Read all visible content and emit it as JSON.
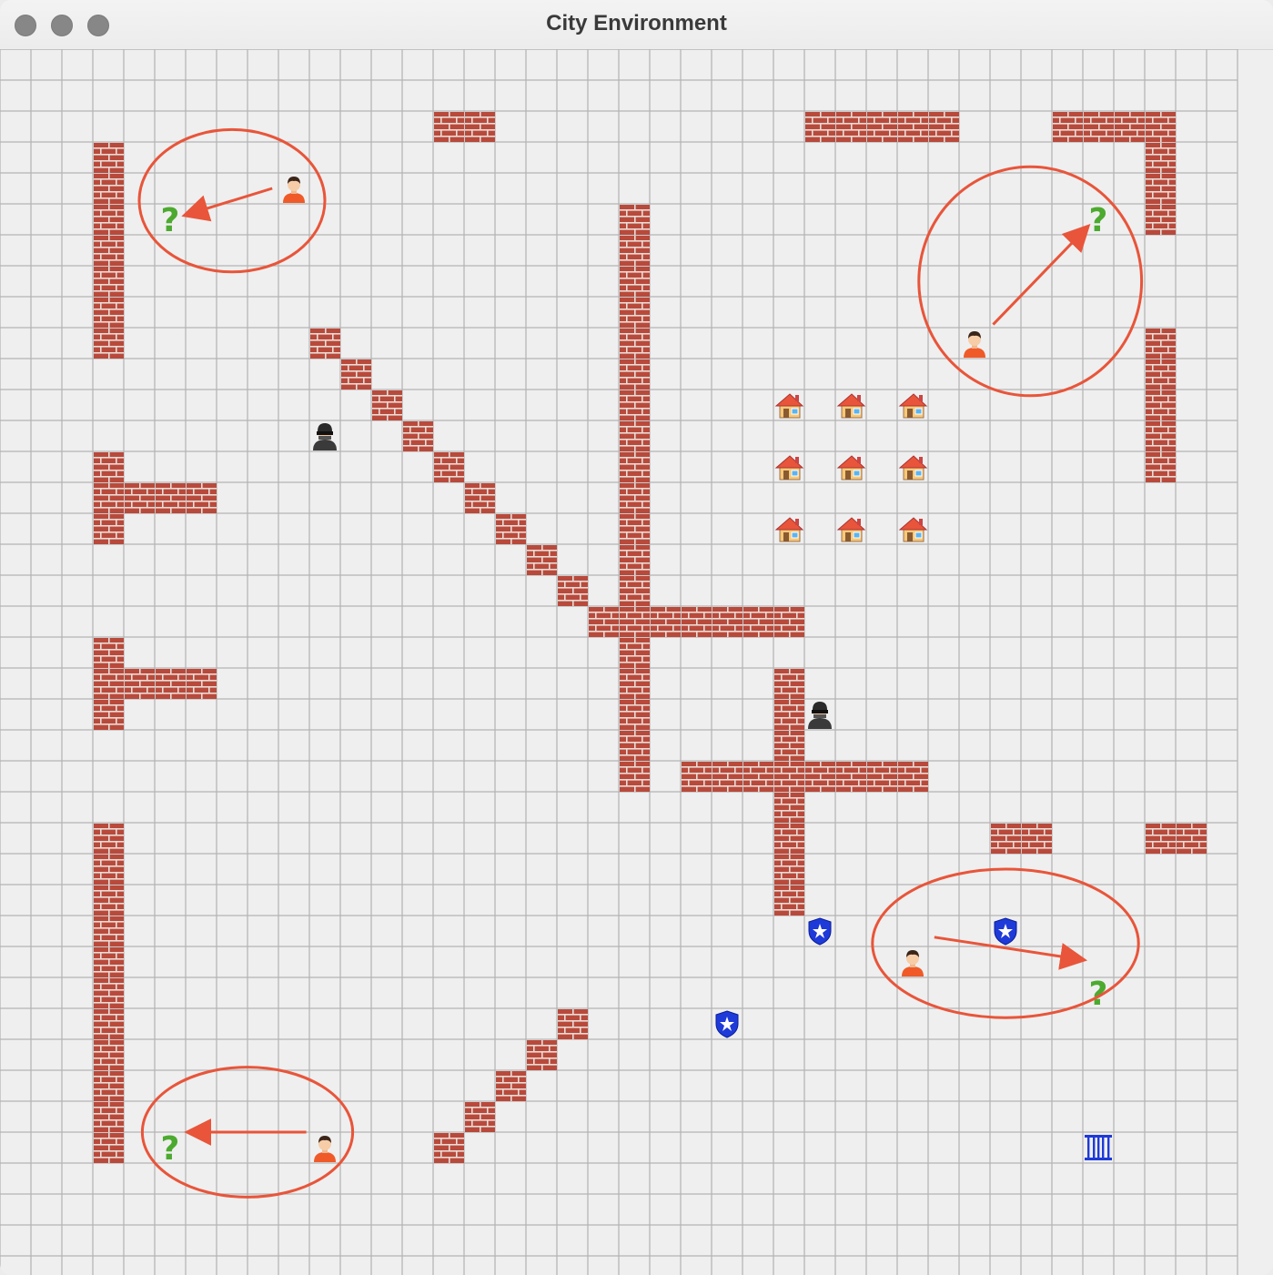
{
  "window": {
    "title": "City Environment",
    "controls": [
      "close",
      "minimize",
      "zoom"
    ]
  },
  "grid": {
    "cols": 40,
    "rows": 40,
    "line_color": "#b5b5b5",
    "background": "#efefef"
  },
  "colors": {
    "brick": "#b84a3c",
    "mortar": "#e9dcd6",
    "annotation": "#e8553a",
    "police": "#1e3ad8",
    "question": "#4caa2f",
    "person_shirt": "#f05a28"
  },
  "walls": [
    [
      14,
      2
    ],
    [
      15,
      2
    ],
    [
      26,
      2
    ],
    [
      27,
      2
    ],
    [
      28,
      2
    ],
    [
      29,
      2
    ],
    [
      30,
      2
    ],
    [
      34,
      2
    ],
    [
      35,
      2
    ],
    [
      36,
      2
    ],
    [
      37,
      2
    ],
    [
      3,
      3
    ],
    [
      3,
      4
    ],
    [
      3,
      5
    ],
    [
      3,
      6
    ],
    [
      3,
      7
    ],
    [
      3,
      8
    ],
    [
      3,
      9
    ],
    [
      37,
      3
    ],
    [
      37,
      4
    ],
    [
      37,
      5
    ],
    [
      20,
      5
    ],
    [
      20,
      6
    ],
    [
      20,
      7
    ],
    [
      20,
      8
    ],
    [
      20,
      9
    ],
    [
      20,
      10
    ],
    [
      20,
      11
    ],
    [
      20,
      12
    ],
    [
      20,
      13
    ],
    [
      20,
      14
    ],
    [
      20,
      15
    ],
    [
      20,
      16
    ],
    [
      20,
      17
    ],
    [
      10,
      9
    ],
    [
      11,
      10
    ],
    [
      12,
      11
    ],
    [
      13,
      12
    ],
    [
      14,
      13
    ],
    [
      15,
      14
    ],
    [
      16,
      15
    ],
    [
      17,
      16
    ],
    [
      18,
      17
    ],
    [
      37,
      9
    ],
    [
      37,
      10
    ],
    [
      37,
      11
    ],
    [
      37,
      12
    ],
    [
      37,
      13
    ],
    [
      3,
      13
    ],
    [
      3,
      14
    ],
    [
      4,
      14
    ],
    [
      5,
      14
    ],
    [
      6,
      14
    ],
    [
      3,
      15
    ],
    [
      19,
      18
    ],
    [
      20,
      18
    ],
    [
      21,
      18
    ],
    [
      22,
      18
    ],
    [
      23,
      18
    ],
    [
      24,
      18
    ],
    [
      25,
      18
    ],
    [
      3,
      19
    ],
    [
      3,
      20
    ],
    [
      4,
      20
    ],
    [
      5,
      20
    ],
    [
      6,
      20
    ],
    [
      3,
      21
    ],
    [
      20,
      19
    ],
    [
      20,
      20
    ],
    [
      20,
      21
    ],
    [
      20,
      22
    ],
    [
      20,
      23
    ],
    [
      25,
      20
    ],
    [
      25,
      21
    ],
    [
      25,
      22
    ],
    [
      22,
      23
    ],
    [
      23,
      23
    ],
    [
      24,
      23
    ],
    [
      25,
      23
    ],
    [
      26,
      23
    ],
    [
      27,
      23
    ],
    [
      28,
      23
    ],
    [
      29,
      23
    ],
    [
      25,
      24
    ],
    [
      25,
      25
    ],
    [
      25,
      26
    ],
    [
      25,
      27
    ],
    [
      3,
      25
    ],
    [
      3,
      26
    ],
    [
      3,
      27
    ],
    [
      3,
      28
    ],
    [
      3,
      29
    ],
    [
      3,
      30
    ],
    [
      3,
      31
    ],
    [
      3,
      32
    ],
    [
      3,
      33
    ],
    [
      3,
      34
    ],
    [
      3,
      35
    ],
    [
      32,
      25
    ],
    [
      33,
      25
    ],
    [
      37,
      25
    ],
    [
      38,
      25
    ],
    [
      18,
      31
    ],
    [
      17,
      32
    ],
    [
      16,
      33
    ],
    [
      15,
      34
    ],
    [
      14,
      35
    ]
  ],
  "houses": [
    [
      25,
      11
    ],
    [
      27,
      11
    ],
    [
      29,
      11
    ],
    [
      25,
      13
    ],
    [
      27,
      13
    ],
    [
      29,
      13
    ],
    [
      25,
      15
    ],
    [
      27,
      15
    ],
    [
      29,
      15
    ]
  ],
  "thieves": [
    [
      10,
      12
    ],
    [
      26,
      21
    ]
  ],
  "police_stations": [
    [
      26,
      28
    ],
    [
      32,
      28
    ],
    [
      23,
      31
    ]
  ],
  "jail": [
    [
      35,
      35
    ]
  ],
  "people": [
    [
      9,
      4
    ],
    [
      31,
      9
    ],
    [
      29,
      29
    ],
    [
      10,
      35
    ]
  ],
  "destinations": [
    [
      5,
      5
    ],
    [
      35,
      5
    ],
    [
      35,
      30
    ],
    [
      5,
      35
    ]
  ],
  "annotations": [
    {
      "ellipse": [
        7.5,
        4.9,
        3.0,
        2.3
      ],
      "from": [
        8.8,
        4.5
      ],
      "to": [
        6.2,
        5.3
      ]
    },
    {
      "ellipse": [
        33.3,
        7.5,
        3.6,
        3.7
      ],
      "from": [
        32.1,
        8.9
      ],
      "to": [
        35.0,
        5.9
      ]
    },
    {
      "ellipse": [
        32.5,
        28.9,
        4.3,
        2.4
      ],
      "from": [
        30.2,
        28.7
      ],
      "to": [
        34.8,
        29.4
      ]
    },
    {
      "ellipse": [
        8.0,
        35.0,
        3.4,
        2.1
      ],
      "from": [
        9.9,
        35.0
      ],
      "to": [
        6.3,
        35.0
      ]
    }
  ]
}
